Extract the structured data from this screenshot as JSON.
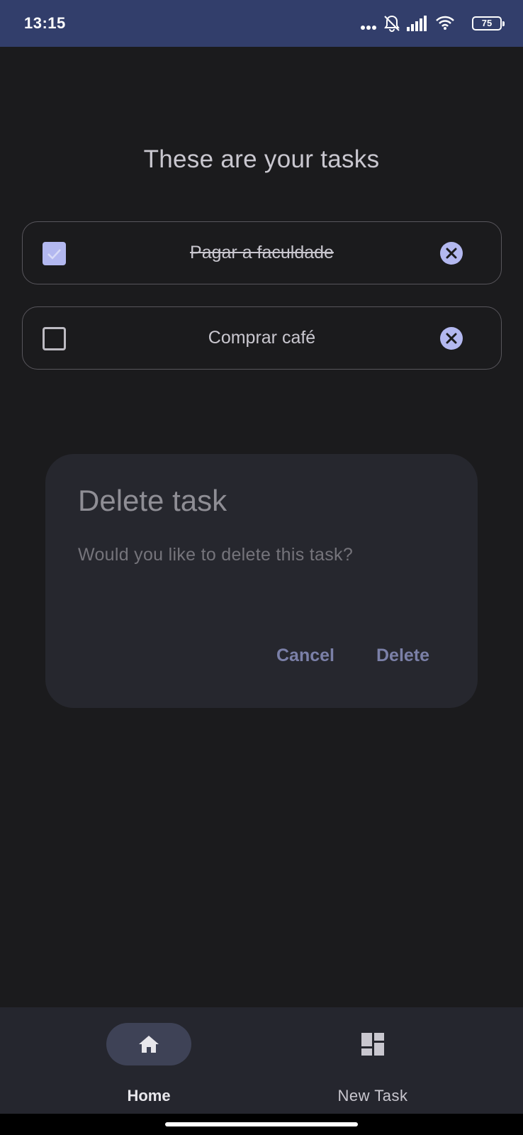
{
  "status_bar": {
    "time": "13:15",
    "battery": "75",
    "icons": [
      "more-dots-icon",
      "notifications-off-icon",
      "signal-icon",
      "wifi-icon",
      "battery-icon"
    ]
  },
  "page": {
    "title": "These are your tasks"
  },
  "tasks": [
    {
      "label": "Pagar a faculdade",
      "done": true
    },
    {
      "label": "Comprar café",
      "done": false
    }
  ],
  "dialog": {
    "title": "Delete task",
    "message": "Would you like to delete this task?",
    "cancel_label": "Cancel",
    "confirm_label": "Delete"
  },
  "bottom_nav": {
    "items": [
      {
        "label": "Home",
        "icon": "home-icon",
        "selected": true
      },
      {
        "label": "New Task",
        "icon": "dashboard-icon",
        "selected": false
      }
    ]
  },
  "colors": {
    "background": "#1b1b1d",
    "status_bar": "#323e6b",
    "accent": "#b3b8f0",
    "dialog_surface": "#26272e",
    "dialog_button": "#7b80a8",
    "nav_surface": "#25262e"
  }
}
